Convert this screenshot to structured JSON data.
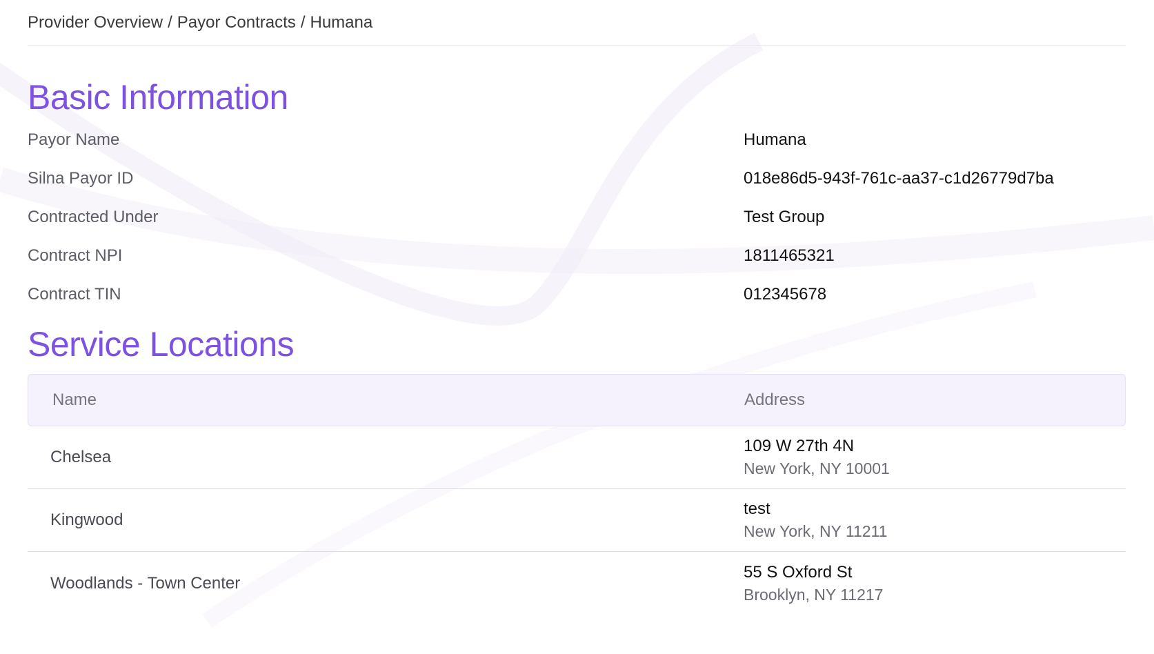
{
  "breadcrumb": {
    "items": [
      "Provider Overview",
      "Payor Contracts",
      "Humana"
    ],
    "separator": "/"
  },
  "basic_information": {
    "title": "Basic Information",
    "rows": [
      {
        "label": "Payor Name",
        "value": "Humana"
      },
      {
        "label": "Silna Payor ID",
        "value": "018e86d5-943f-761c-aa37-c1d26779d7ba"
      },
      {
        "label": "Contracted Under",
        "value": "Test Group"
      },
      {
        "label": "Contract NPI",
        "value": "1811465321"
      },
      {
        "label": "Contract TIN",
        "value": "012345678"
      }
    ]
  },
  "service_locations": {
    "title": "Service Locations",
    "columns": {
      "name": "Name",
      "address": "Address"
    },
    "rows": [
      {
        "name": "Chelsea",
        "address_line1": "109 W 27th 4N",
        "address_line2": "New York, NY 10001"
      },
      {
        "name": "Kingwood",
        "address_line1": "test",
        "address_line2": "New York, NY 11211"
      },
      {
        "name": "Woodlands - Town Center",
        "address_line1": "55 S Oxford St",
        "address_line2": "Brooklyn, NY 11217"
      }
    ]
  },
  "colors": {
    "accent": "#7d52e0",
    "header_bg": "#f5f1fd",
    "divider": "#dcdce0"
  }
}
